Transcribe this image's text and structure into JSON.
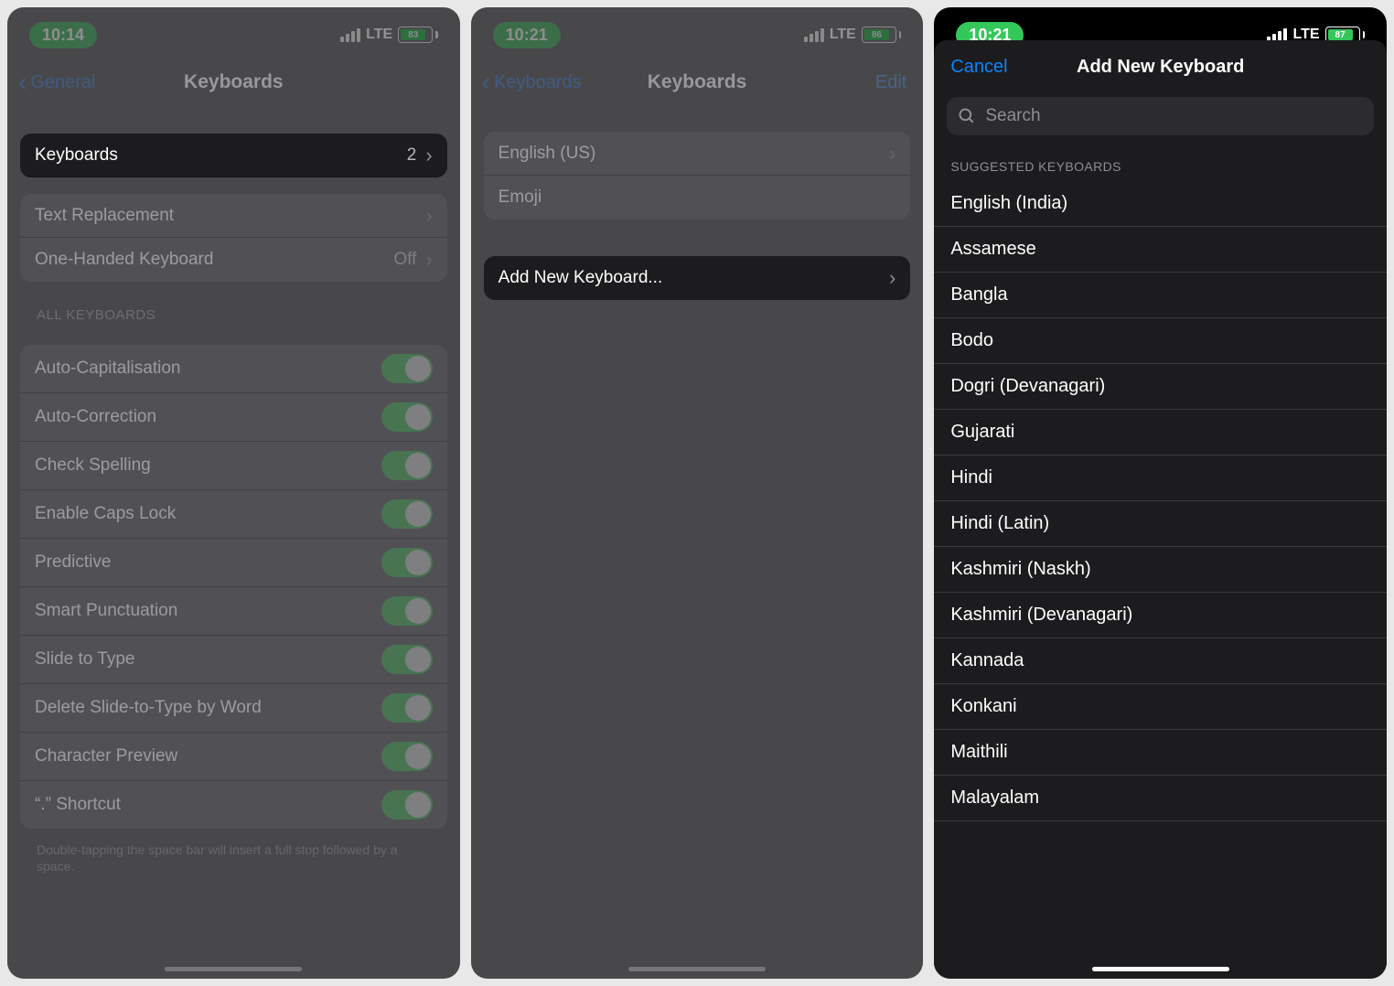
{
  "status": {
    "cellular": "LTE"
  },
  "screen1": {
    "time": "10:14",
    "battery": "83",
    "back": "General",
    "title": "Keyboards",
    "rows": {
      "keyboards": "Keyboards",
      "keyboards_count": "2",
      "textrepl": "Text Replacement",
      "onehand": "One-Handed Keyboard",
      "onehand_val": "Off"
    },
    "section": "ALL KEYBOARDS",
    "toggles": [
      "Auto-Capitalisation",
      "Auto-Correction",
      "Check Spelling",
      "Enable Caps Lock",
      "Predictive",
      "Smart Punctuation",
      "Slide to Type",
      "Delete Slide-to-Type by Word",
      "Character Preview",
      "“.” Shortcut"
    ],
    "footer": "Double-tapping the space bar will insert a full stop followed by a space."
  },
  "screen2": {
    "time": "10:21",
    "battery": "86",
    "back": "Keyboards",
    "title": "Keyboards",
    "edit": "Edit",
    "items": [
      "English (US)",
      "Emoji"
    ],
    "add": "Add New Keyboard..."
  },
  "screen3": {
    "time": "10:21",
    "battery": "87",
    "cancel": "Cancel",
    "title": "Add New Keyboard",
    "search_placeholder": "Search",
    "section": "SUGGESTED KEYBOARDS",
    "items": [
      "English (India)",
      "Assamese",
      "Bangla",
      "Bodo",
      "Dogri (Devanagari)",
      "Gujarati",
      "Hindi",
      "Hindi (Latin)",
      "Kashmiri (Naskh)",
      "Kashmiri (Devanagari)",
      "Kannada",
      "Konkani",
      "Maithili",
      "Malayalam"
    ]
  }
}
